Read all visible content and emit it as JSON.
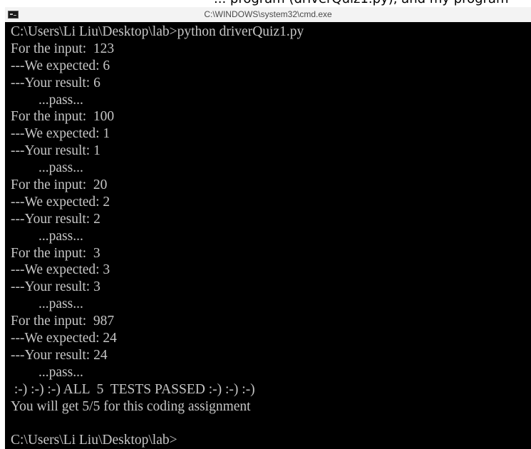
{
  "top_strip": {
    "text": "... program (driverQuiz1.py), and my program"
  },
  "window": {
    "title": "C:\\WINDOWS\\system32\\cmd.exe",
    "icon": "cmd-icon",
    "colors": {
      "background": "#000000",
      "text": "#c6c6c6",
      "title_bar": "#f3f3f3"
    }
  },
  "console": {
    "lines": [
      "C:\\Users\\Li Liu\\Desktop\\lab>python driverQuiz1.py",
      "For the input:  123",
      "---We expected: 6",
      "---Your result: 6",
      "        ...pass...",
      "For the input:  100",
      "---We expected: 1",
      "---Your result: 1",
      "        ...pass...",
      "For the input:  20",
      "---We expected: 2",
      "---Your result: 2",
      "        ...pass...",
      "For the input:  3",
      "---We expected: 3",
      "---Your result: 3",
      "        ...pass...",
      "For the input:  987",
      "---We expected: 24",
      "---Your result: 24",
      "        ...pass...",
      " :-) :-) :-) ALL  5  TESTS PASSED :-) :-) :-)",
      "You will get 5/5 for this coding assignment",
      "",
      "C:\\Users\\Li Liu\\Desktop\\lab>"
    ]
  }
}
